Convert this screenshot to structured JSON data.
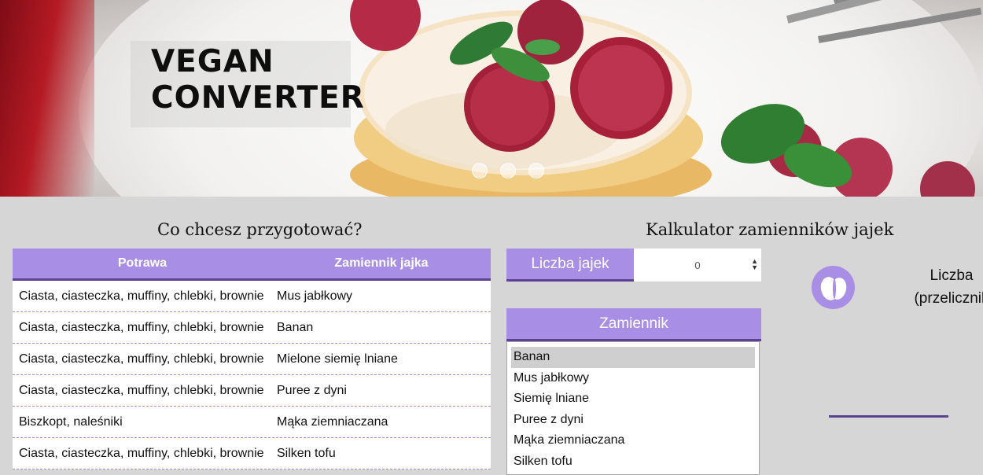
{
  "hero": {
    "title_line1": "VEGAN",
    "title_line2": "CONVERTER",
    "slider_dots": 3
  },
  "table_section": {
    "title": "Co chcesz przygotować?",
    "headers": [
      "Potrawa",
      "Zamiennik jajka"
    ],
    "rows": [
      [
        "Ciasta, ciasteczka, muffiny, chlebki, brownie",
        "Mus jabłkowy"
      ],
      [
        "Ciasta, ciasteczka, muffiny, chlebki, brownie",
        "Banan"
      ],
      [
        "Ciasta, ciasteczka, muffiny, chlebki, brownie",
        "Mielone siemię lniane"
      ],
      [
        "Ciasta, ciasteczka, muffiny, chlebki, brownie",
        "Puree z dyni"
      ],
      [
        "Biszkopt, naleśniki",
        "Mąka ziemniaczana"
      ],
      [
        "Ciasta, ciasteczka, muffiny, chlebki, brownie",
        "Silken tofu"
      ]
    ]
  },
  "calculator": {
    "title": "Kalkulator zamienników jajek",
    "eggs_label": "Liczba jajek",
    "eggs_value": "0",
    "substitute_header": "Zamiennik",
    "substitutes": [
      "Banan",
      "Mus jabłkowy",
      "Siemię lniane",
      "Puree z dyni",
      "Mąka ziemniaczana",
      "Silken tofu"
    ],
    "selected_substitute": "Banan",
    "result_label_line1": "Liczba",
    "result_label_line2": "(przelicznik"
  },
  "colors": {
    "accent": "#a98ee6",
    "accent_dark": "#5a4393",
    "background": "#d6d6d6"
  }
}
